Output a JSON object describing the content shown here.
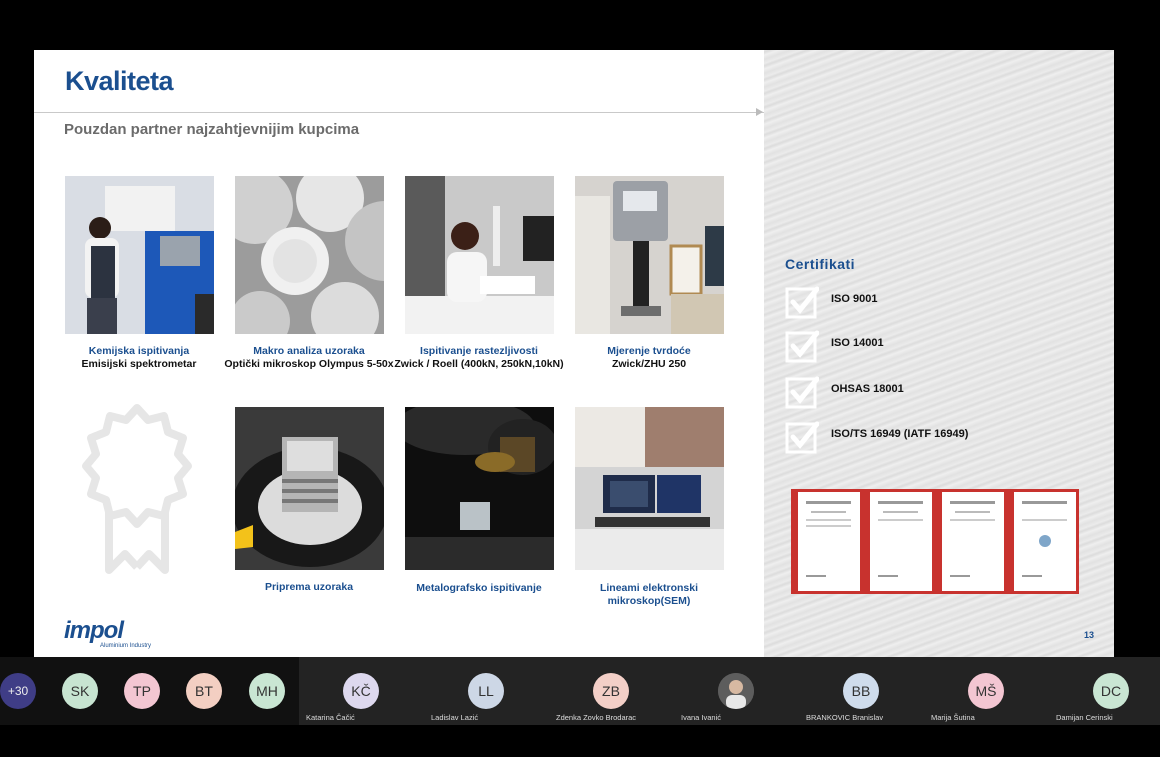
{
  "slide": {
    "title": "Kvaliteta",
    "subtitle": "Pouzdan partner najzahtjevnijim kupcima",
    "captions": [
      {
        "blue": "Kemijska ispitivanja",
        "black": "Emisijski spektrometar"
      },
      {
        "blue": "Makro analiza uzoraka",
        "black": "Optički mikroskop Olympus 5-50x"
      },
      {
        "blue": "Ispitivanje rastezljivosti",
        "black": "Zwick / Roell (400kN, 250kN,10kN)"
      },
      {
        "blue": "Mjerenje tvrdoće",
        "black": "Zwick/ZHU 250"
      },
      {
        "blue": "Priprema uzoraka",
        "black": ""
      },
      {
        "blue": "Metalografsko ispitivanje",
        "black": ""
      },
      {
        "blue": "Lineami elektronski mikroskop(SEM)",
        "black": ""
      }
    ],
    "cert_title": "Certifikati",
    "certs": [
      "ISO 9001",
      "ISO 14001",
      "OHSAS 18001",
      "ISO/TS 16949 (IATF 16949)"
    ],
    "logo": {
      "word": "impol",
      "tagline": "Aluminium Industry"
    },
    "page_number": "13",
    "colors": {
      "brand": "#1b4f8f"
    }
  },
  "participants": {
    "overflow": "+30",
    "small": [
      {
        "initials": "SK",
        "color": "#c7e4d1"
      },
      {
        "initials": "TP",
        "color": "#f3c6d2"
      },
      {
        "initials": "BT",
        "color": "#f3cfc2"
      },
      {
        "initials": "MH",
        "color": "#c9e6d3"
      }
    ],
    "tiles": [
      {
        "initials": "KČ",
        "name": "Katarina Čačić",
        "color": "#ddd8ee"
      },
      {
        "initials": "LL",
        "name": "Ladislav Lazić",
        "color": "#cdd7e6"
      },
      {
        "initials": "ZB",
        "name": "Zdenka Zovko Brodarac",
        "color": "#f3cfc7"
      },
      {
        "initials": "",
        "name": "Ivana Ivanić",
        "color": "#555555"
      },
      {
        "initials": "BB",
        "name": "BRANKOVIC Branislav",
        "color": "#cfdcec"
      },
      {
        "initials": "MŠ",
        "name": "Marija Šutina",
        "color": "#f3c6d2"
      },
      {
        "initials": "DC",
        "name": "Damijan Cerinski",
        "color": "#c9e6d3"
      }
    ]
  }
}
